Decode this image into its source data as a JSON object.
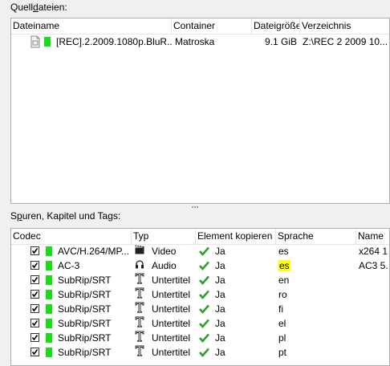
{
  "source_files": {
    "label_pre": "Quell",
    "label_accel": "d",
    "label_post": "ateien:",
    "columns": [
      "Dateiname",
      "Container",
      "Dateigröße",
      "Verzeichnis"
    ],
    "rows": [
      {
        "name": "[REC].2.2009.1080p.BluR...",
        "container": "Matroska",
        "size": "9.1 GiB",
        "directory": "Z:\\REC 2 2009 10...",
        "icon": "file-icon"
      }
    ]
  },
  "tracks": {
    "label_pre": "S",
    "label_accel": "p",
    "label_post": "uren, Kapitel und Tags:",
    "columns": [
      "Codec",
      "Typ",
      "Element kopieren",
      "Sprache",
      "Name"
    ],
    "rows": [
      {
        "codec": "AVC/H.264/MP...",
        "type": "Video",
        "type_icon": "film-icon",
        "copy": "Ja",
        "language": "es",
        "name": "x264 1",
        "checked": true
      },
      {
        "codec": "AC-3",
        "type": "Audio",
        "type_icon": "headphones-icon",
        "copy": "Ja",
        "language": "es",
        "name": "AC3 5.",
        "checked": true,
        "language_highlight": true
      },
      {
        "codec": "SubRip/SRT",
        "type": "Untertitel",
        "type_icon": "text-icon",
        "copy": "Ja",
        "language": "en",
        "name": "",
        "checked": true
      },
      {
        "codec": "SubRip/SRT",
        "type": "Untertitel",
        "type_icon": "text-icon",
        "copy": "Ja",
        "language": "ro",
        "name": "",
        "checked": true
      },
      {
        "codec": "SubRip/SRT",
        "type": "Untertitel",
        "type_icon": "text-icon",
        "copy": "Ja",
        "language": "fi",
        "name": "",
        "checked": true
      },
      {
        "codec": "SubRip/SRT",
        "type": "Untertitel",
        "type_icon": "text-icon",
        "copy": "Ja",
        "language": "el",
        "name": "",
        "checked": true
      },
      {
        "codec": "SubRip/SRT",
        "type": "Untertitel",
        "type_icon": "text-icon",
        "copy": "Ja",
        "language": "pl",
        "name": "",
        "checked": true
      },
      {
        "codec": "SubRip/SRT",
        "type": "Untertitel",
        "type_icon": "text-icon",
        "copy": "Ja",
        "language": "pt",
        "name": "",
        "checked": true
      }
    ]
  },
  "colors": {
    "status_green": "#14e014",
    "highlight": "#ffff00",
    "check_green": "#2e9e2e"
  }
}
